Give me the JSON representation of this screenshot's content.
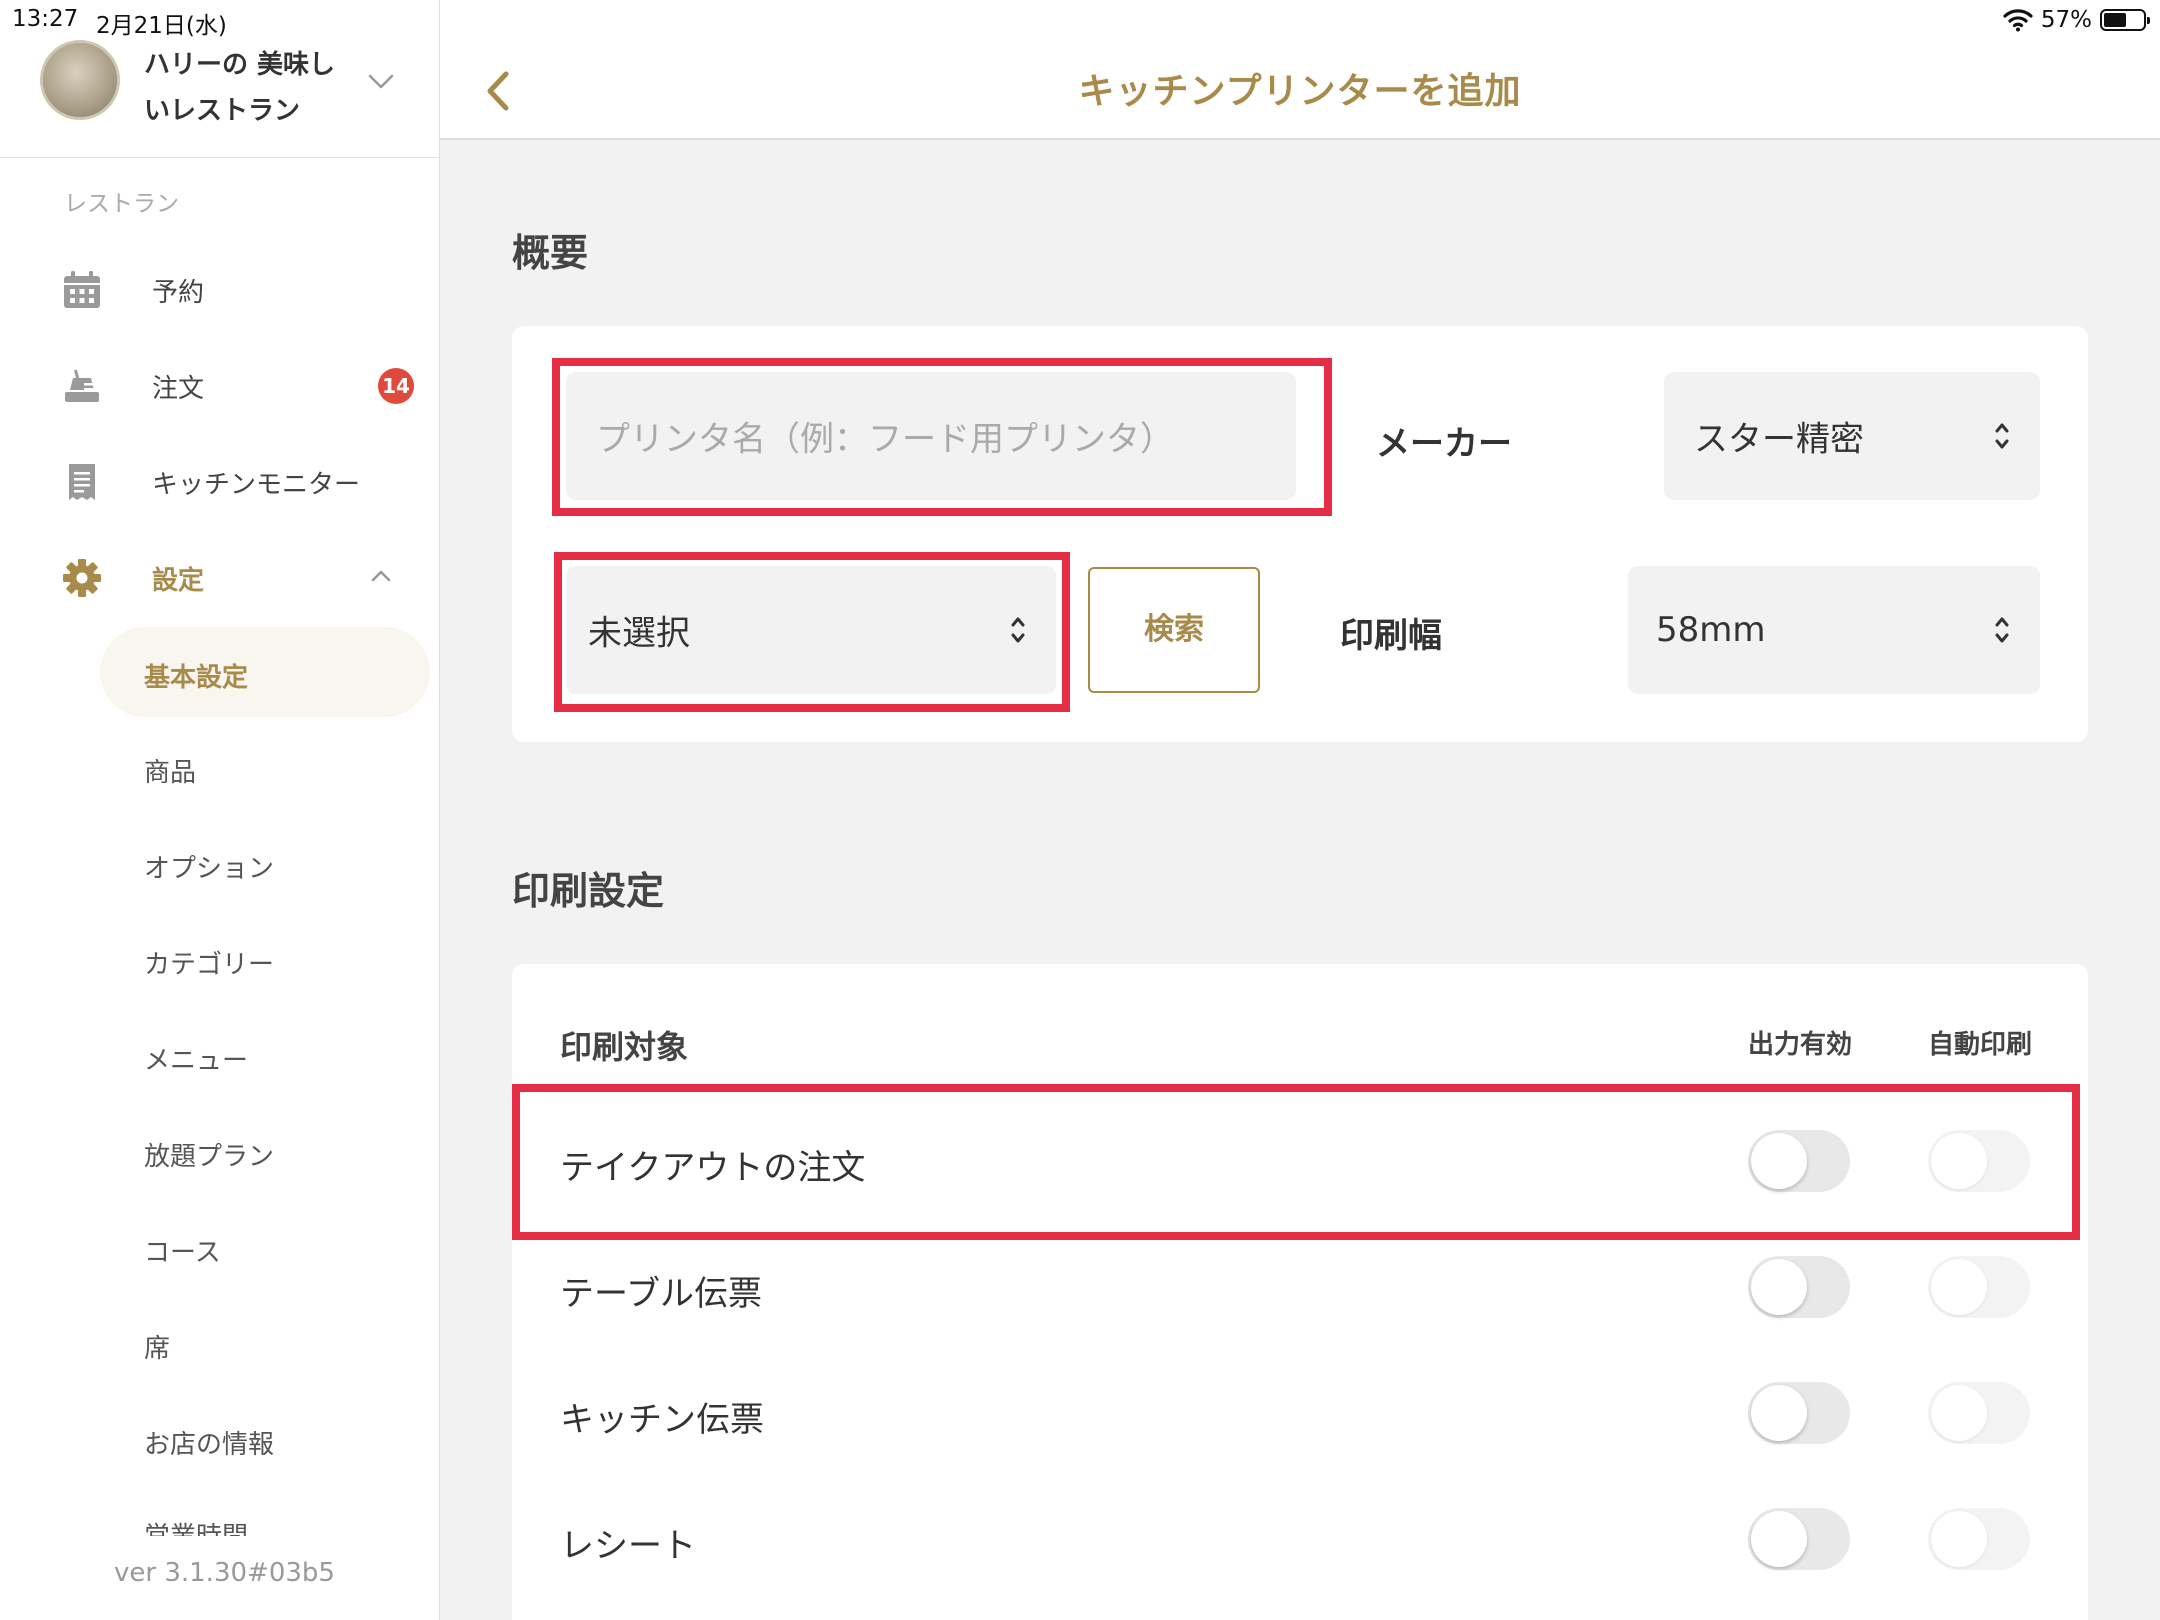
{
  "status": {
    "time": "13:27",
    "date": "2月21日(水)",
    "battery": "57%",
    "battery_level": 0.57
  },
  "sidebar": {
    "account_name_line1": "ハリーの 美味し",
    "account_name_line2": "いレストラン",
    "section_label": "レストラン",
    "nav": [
      {
        "label": "予約",
        "icon": "calendar-icon"
      },
      {
        "label": "注文",
        "icon": "takeout-icon",
        "badge": "14"
      },
      {
        "label": "キッチンモニター",
        "icon": "receipt-icon"
      },
      {
        "label": "設定",
        "icon": "gear-icon"
      }
    ],
    "settings_items": [
      "基本設定",
      "商品",
      "オプション",
      "カテゴリー",
      "メニュー",
      "放題プラン",
      "コース",
      "席",
      "お店の情報",
      "営業時間"
    ],
    "version": "ver 3.1.30#03b5"
  },
  "header": {
    "title": "キッチンプリンターを追加"
  },
  "overview": {
    "title": "概要",
    "printer_name_placeholder": "プリンタ名（例：フード用プリンタ）",
    "maker_label": "メーカー",
    "maker_value": "スター精密",
    "connection_value": "未選択",
    "search_label": "検索",
    "width_label": "印刷幅",
    "width_value": "58mm"
  },
  "print_settings": {
    "title": "印刷設定",
    "target_header": "印刷対象",
    "output_header": "出力有効",
    "auto_header": "自動印刷",
    "rows": [
      {
        "label": "テイクアウトの注文",
        "output_enabled": false,
        "auto_print": false
      },
      {
        "label": "テーブル伝票",
        "output_enabled": false,
        "auto_print": false
      },
      {
        "label": "キッチン伝票",
        "output_enabled": false,
        "auto_print": false
      },
      {
        "label": "レシート",
        "output_enabled": false,
        "auto_print": false
      }
    ]
  },
  "colors": {
    "accent": "#a88a4a",
    "highlight": "#e52d45",
    "badge": "#e04a3c"
  }
}
